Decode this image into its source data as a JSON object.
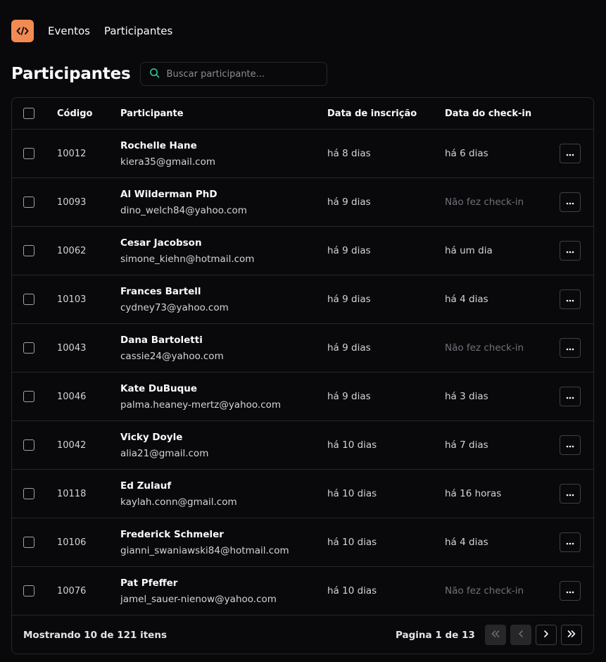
{
  "nav": {
    "logo_icon": "code-brackets-icon",
    "links": [
      "Eventos",
      "Participantes"
    ]
  },
  "page": {
    "title": "Participantes",
    "search_placeholder": "Buscar participante...",
    "search_value": ""
  },
  "table": {
    "headers": {
      "code": "Código",
      "participant": "Participante",
      "registration_date": "Data de inscrição",
      "checkin_date": "Data do check-in"
    },
    "rows": [
      {
        "code": "10012",
        "name": "Rochelle Hane",
        "email": "kiera35@gmail.com",
        "registered": "há 8 dias",
        "checkin": "há 6 dias",
        "checked_in": true
      },
      {
        "code": "10093",
        "name": "Al Wilderman PhD",
        "email": "dino_welch84@yahoo.com",
        "registered": "há 9 dias",
        "checkin": "Não fez check-in",
        "checked_in": false
      },
      {
        "code": "10062",
        "name": "Cesar Jacobson",
        "email": "simone_kiehn@hotmail.com",
        "registered": "há 9 dias",
        "checkin": "há um dia",
        "checked_in": true
      },
      {
        "code": "10103",
        "name": "Frances Bartell",
        "email": "cydney73@yahoo.com",
        "registered": "há 9 dias",
        "checkin": "há 4 dias",
        "checked_in": true
      },
      {
        "code": "10043",
        "name": "Dana Bartoletti",
        "email": "cassie24@yahoo.com",
        "registered": "há 9 dias",
        "checkin": "Não fez check-in",
        "checked_in": false
      },
      {
        "code": "10046",
        "name": "Kate DuBuque",
        "email": "palma.heaney-mertz@yahoo.com",
        "registered": "há 9 dias",
        "checkin": "há 3 dias",
        "checked_in": true
      },
      {
        "code": "10042",
        "name": "Vicky Doyle",
        "email": "alia21@gmail.com",
        "registered": "há 10 dias",
        "checkin": "há 7 dias",
        "checked_in": true
      },
      {
        "code": "10118",
        "name": "Ed Zulauf",
        "email": "kaylah.conn@gmail.com",
        "registered": "há 10 dias",
        "checkin": "há 16 horas",
        "checked_in": true
      },
      {
        "code": "10106",
        "name": "Frederick Schmeler",
        "email": "gianni_swaniawski84@hotmail.com",
        "registered": "há 10 dias",
        "checkin": "há 4 dias",
        "checked_in": true
      },
      {
        "code": "10076",
        "name": "Pat Pfeffer",
        "email": "jamel_sauer-nienow@yahoo.com",
        "registered": "há 10 dias",
        "checkin": "Não fez check-in",
        "checked_in": false
      }
    ],
    "row_action_icon": "more-horizontal-icon"
  },
  "footer": {
    "showing_text": "Mostrando 10 de 121 itens",
    "page_text": "Pagina 1 de 13",
    "buttons": [
      {
        "icon": "chevrons-left-icon",
        "enabled": false
      },
      {
        "icon": "chevron-left-icon",
        "enabled": false
      },
      {
        "icon": "chevron-right-icon",
        "enabled": true
      },
      {
        "icon": "chevrons-right-icon",
        "enabled": true
      }
    ]
  },
  "colors": {
    "background": "#09090b",
    "border": "#27272a",
    "accent": "#f28b52",
    "muted_text": "#71717a"
  }
}
